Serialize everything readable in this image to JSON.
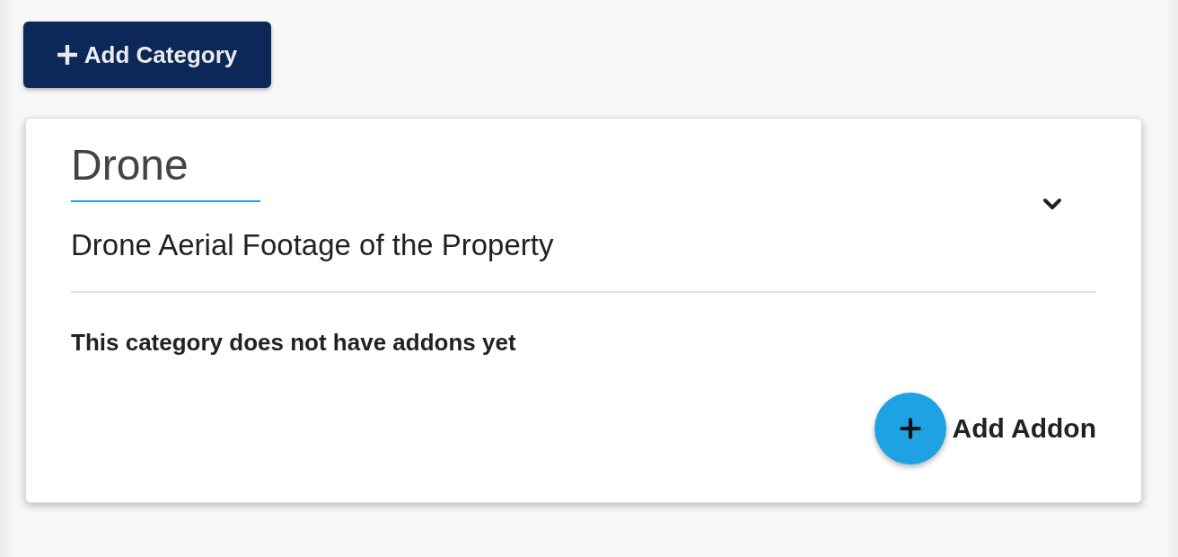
{
  "add_category_button": {
    "label": "Add Category"
  },
  "categories": [
    {
      "name": "Drone",
      "description": "Drone Aerial Footage of the Property",
      "empty_message": "This category does not have addons yet",
      "add_addon_label": "Add Addon"
    }
  ]
}
